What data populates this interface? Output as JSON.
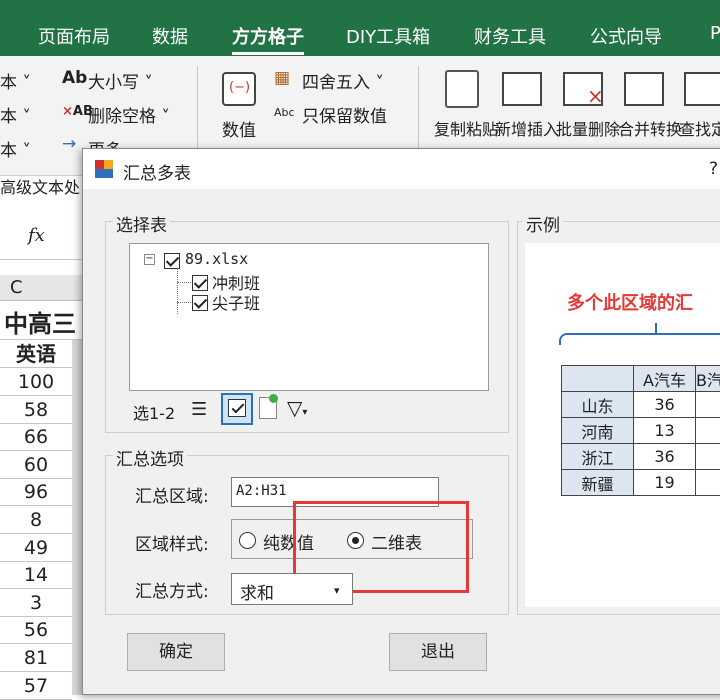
{
  "ribbon_tabs": [
    "页面布局",
    "数据",
    "方方格子",
    "DIY工具箱",
    "财务工具",
    "公式向导",
    "P"
  ],
  "active_tab": "方方格子",
  "ribbon": {
    "left_items": [
      "本 ˅",
      "本 ˅",
      "本 ˅"
    ],
    "case_label": "大小写 ˅",
    "delete_space_label": "删除空格 ˅",
    "more_label": "更多",
    "advanced_text_label": "高级文本处",
    "number_label": "数值",
    "round_label": "四舍五入 ˅",
    "keep_number_label": "只保留数值",
    "buttons": [
      "复制粘贴",
      "新增插入",
      "批量删除",
      "合并转换",
      "查找定"
    ]
  },
  "formula": {
    "fx_label": "fx"
  },
  "sheet": {
    "column_header": "C",
    "title_partial": "中高三",
    "header_cell": "英语",
    "values": [
      "100",
      "58",
      "66",
      "60",
      "96",
      "8",
      "49",
      "14",
      "3",
      "56",
      "81",
      "57"
    ]
  },
  "dialog": {
    "title": "汇总多表",
    "help": "?",
    "select_group_label": "选择表",
    "tree": {
      "file": "89.xlsx",
      "expander": "−",
      "sheets": [
        "冲刺班",
        "尖子班"
      ]
    },
    "selection_count": "选1-2",
    "options_group_label": "汇总选项",
    "area_label": "汇总区域:",
    "area_value": "A2:H31",
    "style_label": "区域样式:",
    "style_options": [
      "纯数值",
      "二维表"
    ],
    "style_selected": "二维表",
    "method_label": "汇总方式:",
    "method_value": "求和",
    "confirm_label": "确定",
    "exit_label": "退出",
    "example_label": "示例",
    "example": {
      "caption": "多个此区域的汇",
      "header": [
        "",
        "A汽车",
        "B汽"
      ],
      "rows": [
        [
          "山东",
          "36",
          ""
        ],
        [
          "河南",
          "13",
          ""
        ],
        [
          "浙江",
          "36",
          ""
        ],
        [
          "新疆",
          "19",
          ""
        ]
      ]
    }
  },
  "colors": {
    "excel_green": "#217346",
    "highlight_red": "#e53935",
    "example_red": "#e53935",
    "brace_blue": "#2f6fba"
  }
}
